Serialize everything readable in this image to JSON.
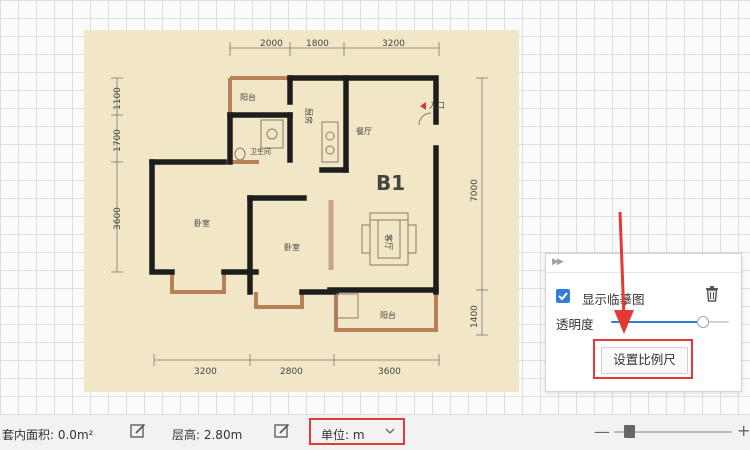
{
  "floorplan": {
    "unit_name": "B1",
    "top_dims": [
      "2000",
      "1800",
      "3200"
    ],
    "bottom_dims": [
      "3200",
      "2800",
      "3600"
    ],
    "left_dims": [
      "1100",
      "1700",
      "3600"
    ],
    "right_dims": [
      "7000",
      "1400"
    ],
    "rooms": {
      "balcony_top": "阳台",
      "kitchen": "厨房",
      "dining": "餐厅",
      "entrance": "入口",
      "bathroom": "卫生间",
      "bedroom_left": "卧室",
      "bedroom_mid": "卧室",
      "living": "客厅",
      "balcony_bottom": "阳台"
    }
  },
  "panel": {
    "collapse_icon": "double-chevron-right-icon",
    "show_reference_label": "显示临摹图",
    "show_reference_checked": true,
    "opacity_label": "透明度",
    "opacity_value": 0.78,
    "set_scale_button": "设置比例尺",
    "accent_color": "#2f7fd8",
    "highlight_color": "#e53935"
  },
  "status_bar": {
    "area_label": "套内面积: 0.0m²",
    "height_label": "层高: 2.80m",
    "unit_label": "单位: m",
    "zoom_value": 0.1
  }
}
